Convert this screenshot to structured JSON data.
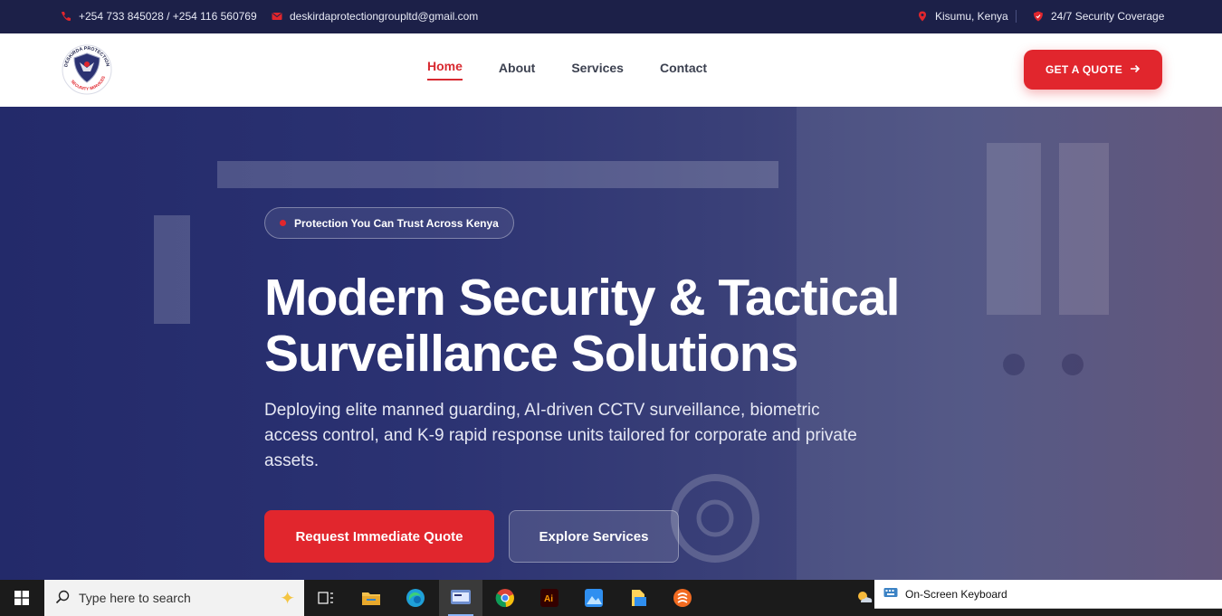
{
  "topbar": {
    "phone": "+254 733 845028 / +254 116 560769",
    "email": "deskirdaprotectiongroupltd@gmail.com",
    "location": "Kisumu, Kenya",
    "coverage": "24/7 Security Coverage"
  },
  "header": {
    "logo_text": "DESKIRDA PROTECTION SECURITY SERVICES",
    "nav": [
      "Home",
      "About",
      "Services",
      "Contact"
    ],
    "cta": "GET A QUOTE"
  },
  "hero": {
    "badge": "Protection You Can Trust Across Kenya",
    "headline_line1": "Modern Security & Tactical",
    "headline_line2": "Surveillance Solutions",
    "subtext": "Deploying elite manned guarding, AI-driven CCTV surveillance, biometric access control, and K-9 rapid response units tailored for corporate and private assets.",
    "primary_button": "Request Immediate Quote",
    "secondary_button": "Explore Services"
  },
  "taskbar": {
    "search_placeholder": "Type here to search",
    "osk_label": "On-Screen Keyboard",
    "icons": [
      "task-view-icon",
      "file-explorer-icon",
      "edge-icon",
      "app-window-icon",
      "chrome-icon",
      "illustrator-icon",
      "photos-icon",
      "files-icon",
      "brave-icon"
    ]
  },
  "colors": {
    "accent": "#e1262d",
    "topbar_bg": "#1c2048",
    "hero_bg": "#2b3272"
  }
}
